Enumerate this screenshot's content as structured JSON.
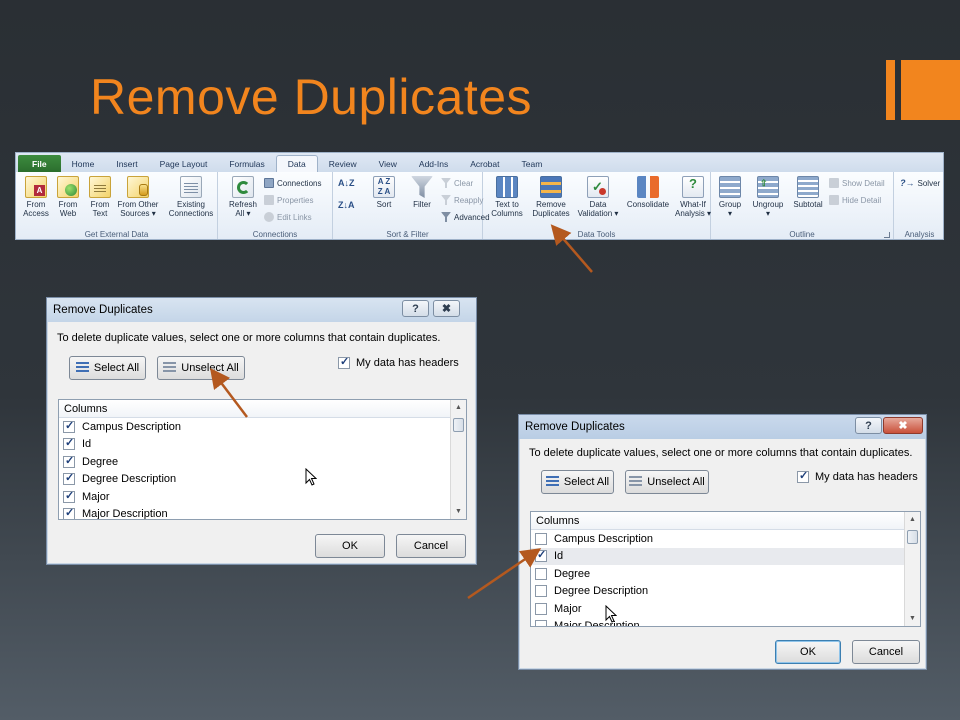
{
  "slide": {
    "title": "Remove Duplicates"
  },
  "ribbon": {
    "tabs": [
      "File",
      "Home",
      "Insert",
      "Page Layout",
      "Formulas",
      "Data",
      "Review",
      "View",
      "Add-Ins",
      "Acrobat",
      "Team"
    ],
    "groups": {
      "external": {
        "label": "Get External Data",
        "from_access": [
          "From",
          "Access"
        ],
        "from_web": [
          "From",
          "Web"
        ],
        "from_text": [
          "From",
          "Text"
        ],
        "from_other": [
          "From Other",
          "Sources ▾"
        ],
        "existing": [
          "Existing",
          "Connections"
        ]
      },
      "connections": {
        "label": "Connections",
        "refresh": [
          "Refresh",
          "All ▾"
        ],
        "connections": "Connections",
        "properties": "Properties",
        "edit_links": "Edit Links"
      },
      "sortfilter": {
        "label": "Sort & Filter",
        "sort": "Sort",
        "filter": "Filter",
        "clear": "Clear",
        "reapply": "Reapply",
        "advanced": "Advanced"
      },
      "datatools": {
        "label": "Data Tools",
        "text_to_columns": [
          "Text to",
          "Columns"
        ],
        "remove_duplicates": [
          "Remove",
          "Duplicates"
        ],
        "data_validation": [
          "Data",
          "Validation ▾"
        ],
        "consolidate": "Consolidate",
        "whatif": [
          "What-If",
          "Analysis ▾"
        ]
      },
      "outline": {
        "label": "Outline",
        "group": [
          "Group",
          "▾"
        ],
        "ungroup": [
          "Ungroup",
          "▾"
        ],
        "subtotal": "Subtotal",
        "show_detail": "Show Detail",
        "hide_detail": "Hide Detail"
      },
      "analysis": {
        "label": "Analysis",
        "solver": "Solver"
      }
    }
  },
  "dialog1": {
    "title": "Remove Duplicates",
    "help": "?",
    "close": "✖",
    "instruction": "To delete duplicate values, select one or more columns that contain duplicates.",
    "select_all": "Select All",
    "unselect_all": "Unselect All",
    "headers": "My data has headers",
    "columns_header": "Columns",
    "rows": [
      {
        "label": "Campus Description",
        "checked": true
      },
      {
        "label": "Id",
        "checked": true
      },
      {
        "label": "Degree",
        "checked": true
      },
      {
        "label": "Degree Description",
        "checked": true
      },
      {
        "label": "Major",
        "checked": true
      },
      {
        "label": "Major Description",
        "checked": true
      }
    ],
    "ok": "OK",
    "cancel": "Cancel"
  },
  "dialog2": {
    "title": "Remove Duplicates",
    "help": "?",
    "close": "✖",
    "instruction": "To delete duplicate values, select one or more columns that contain duplicates.",
    "select_all": "Select All",
    "unselect_all": "Unselect All",
    "headers": "My data has headers",
    "columns_header": "Columns",
    "rows": [
      {
        "label": "Campus Description",
        "checked": false
      },
      {
        "label": "Id",
        "checked": true
      },
      {
        "label": "Degree",
        "checked": false
      },
      {
        "label": "Degree Description",
        "checked": false
      },
      {
        "label": "Major",
        "checked": false
      },
      {
        "label": "Major Description",
        "checked": false
      }
    ],
    "ok": "OK",
    "cancel": "Cancel"
  },
  "colors": {
    "accent": "#f2851e",
    "arrow": "#b4591f"
  }
}
